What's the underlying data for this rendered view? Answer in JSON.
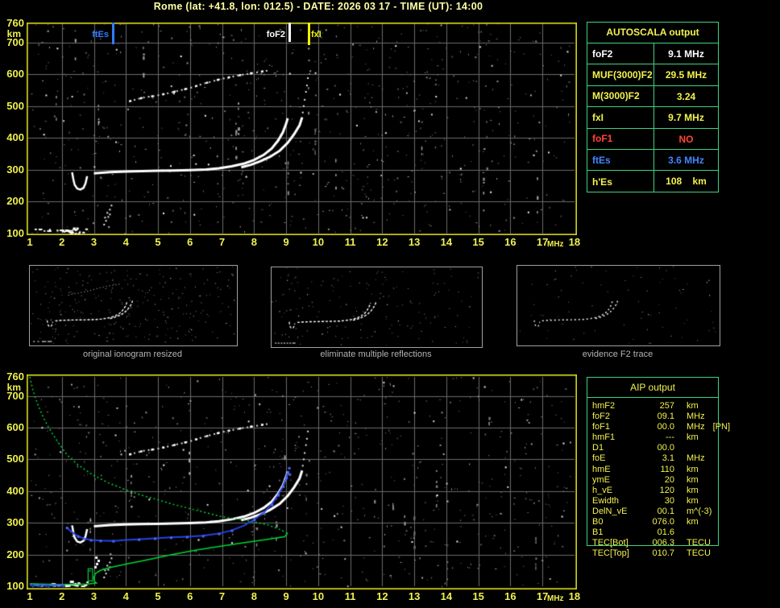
{
  "title": "Rome (lat: +41.8, lon: 012.5) - DATE: 2026 03 17 - TIME (UT): 14:00",
  "autoscala_table": {
    "title": "AUTOSCALA output",
    "rows": [
      {
        "label": "foF2",
        "value": "9.1 MHz",
        "color": "white"
      },
      {
        "label": "MUF(3000)F2",
        "value": "29.5 MHz",
        "color": "yellow"
      },
      {
        "label": "M(3000)F2",
        "value": "3.24",
        "color": "yellow"
      },
      {
        "label": "fxI",
        "value": "9.7 MHz",
        "color": "yellow"
      },
      {
        "label": "foF1",
        "value": "NO",
        "color": "red"
      },
      {
        "label": "ftEs",
        "value": "3.6 MHz",
        "color": "blue"
      },
      {
        "label": "h'Es",
        "value": "108    km",
        "color": "yellow"
      }
    ]
  },
  "aip_table": {
    "title": "AIP output",
    "rows": [
      {
        "label": "hmF2",
        "value": "257",
        "unit": "km",
        "note": ""
      },
      {
        "label": "foF2",
        "value": "09.1",
        "unit": "MHz",
        "note": ""
      },
      {
        "label": "foF1",
        "value": "00.0",
        "unit": "MHz",
        "note": "[PN]"
      },
      {
        "label": "hmF1",
        "value": "---",
        "unit": "km",
        "note": ""
      },
      {
        "label": "D1",
        "value": "00.0",
        "unit": "",
        "note": ""
      },
      {
        "label": "foE",
        "value": "3.1",
        "unit": "MHz",
        "note": ""
      },
      {
        "label": "hmE",
        "value": "110",
        "unit": "km",
        "note": ""
      },
      {
        "label": "ymE",
        "value": "20",
        "unit": "km",
        "note": ""
      },
      {
        "label": "h_vE",
        "value": "120",
        "unit": "km",
        "note": ""
      },
      {
        "label": "Ewidth",
        "value": "30",
        "unit": "km",
        "note": ""
      },
      {
        "label": "DelN_vE",
        "value": "00.1",
        "unit": "m^(-3)",
        "note": ""
      },
      {
        "label": "B0",
        "value": "076.0",
        "unit": "km",
        "note": ""
      },
      {
        "label": "B1",
        "value": "01.6",
        "unit": "",
        "note": ""
      },
      {
        "label": "TEC[Bot]",
        "value": "006.3",
        "unit": "TECU",
        "note": ""
      },
      {
        "label": "TEC[Top]",
        "value": "010.7",
        "unit": "TECU",
        "note": ""
      }
    ]
  },
  "panels": [
    {
      "caption": "original ionogram resized"
    },
    {
      "caption": "eliminate multiple reflections"
    },
    {
      "caption": "evidence F2 trace"
    }
  ],
  "chart_data": {
    "type": "scatter",
    "x_axis": {
      "label": "MHz",
      "range": [
        1,
        18
      ],
      "ticks": [
        "1",
        "2",
        "3",
        "4",
        "5",
        "6",
        "7",
        "8",
        "9",
        "10",
        "11",
        "12",
        "13",
        "14",
        "15",
        "16",
        "17",
        "18"
      ]
    },
    "y_axis": {
      "label": "km",
      "range": [
        100,
        760
      ],
      "ticks": [
        "760",
        "700",
        "600",
        "500",
        "400",
        "300",
        "200",
        "100"
      ]
    },
    "grid": true,
    "markers": [
      {
        "label": "ftEs",
        "mhz": 3.6,
        "color": "#2e7dff"
      },
      {
        "label": "foF2",
        "mhz": 9.1,
        "color": "#ffffff"
      },
      {
        "label": "fxI",
        "mhz": 9.7,
        "color": "#f2f200"
      }
    ],
    "traces": {
      "hook": [
        [
          2.32,
          292
        ],
        [
          2.36,
          270
        ],
        [
          2.4,
          253
        ],
        [
          2.48,
          241
        ],
        [
          2.58,
          238
        ],
        [
          2.68,
          244
        ],
        [
          2.74,
          258
        ],
        [
          2.79,
          280
        ]
      ],
      "o_mode": [
        [
          3.0,
          289
        ],
        [
          3.5,
          293
        ],
        [
          4.0,
          295
        ],
        [
          4.5,
          296
        ],
        [
          5.0,
          297
        ],
        [
          5.5,
          298
        ],
        [
          6.0,
          299
        ],
        [
          6.5,
          301
        ],
        [
          6.9,
          305
        ],
        [
          7.3,
          311
        ],
        [
          7.7,
          320
        ],
        [
          8.0,
          331
        ],
        [
          8.3,
          347
        ],
        [
          8.55,
          367
        ],
        [
          8.75,
          392
        ],
        [
          8.9,
          418
        ],
        [
          9.0,
          445
        ],
        [
          9.05,
          462
        ]
      ],
      "x_mode": [
        [
          7.6,
          308
        ],
        [
          7.9,
          316
        ],
        [
          8.2,
          327
        ],
        [
          8.5,
          341
        ],
        [
          8.8,
          360
        ],
        [
          9.05,
          385
        ],
        [
          9.25,
          412
        ],
        [
          9.42,
          440
        ],
        [
          9.5,
          465
        ]
      ],
      "x_tail": [
        [
          9.52,
          480
        ],
        [
          9.55,
          500
        ],
        [
          9.58,
          520
        ],
        [
          9.62,
          545
        ],
        [
          9.65,
          565
        ],
        [
          9.68,
          588
        ]
      ],
      "second_echo": [
        [
          4.1,
          515
        ],
        [
          4.35,
          522
        ],
        [
          4.6,
          528
        ],
        [
          4.9,
          532
        ],
        [
          5.2,
          538
        ],
        [
          5.5,
          545
        ],
        [
          5.8,
          552
        ],
        [
          6.1,
          560
        ],
        [
          6.4,
          570
        ],
        [
          6.7,
          578
        ],
        [
          7.0,
          586
        ],
        [
          7.3,
          592
        ],
        [
          7.6,
          598
        ],
        [
          7.9,
          603
        ],
        [
          8.2,
          608
        ],
        [
          8.45,
          612
        ]
      ],
      "es_layer": {
        "x_from": 1.15,
        "x_to": 2.85,
        "km": 110
      },
      "es_rise": [
        [
          3.32,
          128
        ],
        [
          3.38,
          140
        ],
        [
          3.45,
          152
        ],
        [
          3.35,
          150
        ],
        [
          3.42,
          165
        ],
        [
          3.5,
          175
        ],
        [
          3.5,
          160
        ],
        [
          3.55,
          188
        ]
      ],
      "fitted_blue": [
        [
          2.15,
          285
        ],
        [
          2.3,
          272
        ],
        [
          2.5,
          258
        ],
        [
          2.7,
          250
        ],
        [
          2.9,
          246
        ],
        [
          3.2,
          244
        ],
        [
          3.6,
          243
        ],
        [
          4.0,
          246
        ],
        [
          4.4,
          248
        ],
        [
          4.9,
          251
        ],
        [
          5.4,
          254
        ],
        [
          5.9,
          256
        ],
        [
          6.4,
          259
        ],
        [
          6.9,
          266
        ],
        [
          7.3,
          276
        ],
        [
          7.7,
          292
        ],
        [
          8.0,
          310
        ],
        [
          8.3,
          332
        ],
        [
          8.55,
          358
        ],
        [
          8.75,
          388
        ],
        [
          8.9,
          415
        ],
        [
          9.0,
          442
        ],
        [
          9.05,
          460
        ]
      ],
      "blue_strays": [
        [
          9.12,
          452
        ],
        [
          9.1,
          472
        ]
      ],
      "blue_es": {
        "x_from": 1.0,
        "x_to": 2.05,
        "km": 104
      },
      "profile_upper": [
        [
          1.0,
          760
        ],
        [
          1.08,
          725
        ],
        [
          1.18,
          692
        ],
        [
          1.32,
          655
        ],
        [
          1.48,
          620
        ],
        [
          1.68,
          585
        ],
        [
          1.92,
          548
        ],
        [
          2.18,
          512
        ],
        [
          2.5,
          483
        ],
        [
          2.95,
          452
        ],
        [
          3.45,
          426
        ],
        [
          3.95,
          406
        ],
        [
          4.45,
          388
        ],
        [
          4.95,
          374
        ],
        [
          5.45,
          359
        ],
        [
          5.95,
          346
        ],
        [
          6.45,
          333
        ],
        [
          6.95,
          320
        ],
        [
          7.45,
          312
        ],
        [
          7.95,
          304
        ],
        [
          8.45,
          293
        ],
        [
          8.85,
          277
        ],
        [
          9.05,
          267
        ]
      ],
      "profile_lower": [
        [
          9.05,
          267
        ],
        [
          8.95,
          256
        ],
        [
          8.5,
          249
        ],
        [
          7.8,
          239
        ],
        [
          7.0,
          227
        ],
        [
          6.2,
          214
        ],
        [
          5.4,
          199
        ],
        [
          4.6,
          182
        ],
        [
          4.0,
          170
        ],
        [
          3.5,
          159
        ],
        [
          3.2,
          150
        ],
        [
          3.05,
          140
        ],
        [
          3.0,
          128
        ],
        [
          3.02,
          115
        ],
        [
          3.08,
          110
        ],
        [
          2.8,
          107
        ],
        [
          2.3,
          106
        ],
        [
          1.8,
          106
        ],
        [
          1.3,
          107
        ],
        [
          1.0,
          108
        ]
      ],
      "green_box": {
        "x_from": 2.82,
        "x_to": 2.96,
        "km_from": 117,
        "km_to": 155
      },
      "white_blob": [
        [
          3.05,
          160
        ],
        [
          3.1,
          170
        ],
        [
          3.15,
          180
        ],
        [
          3.08,
          190
        ]
      ]
    }
  }
}
